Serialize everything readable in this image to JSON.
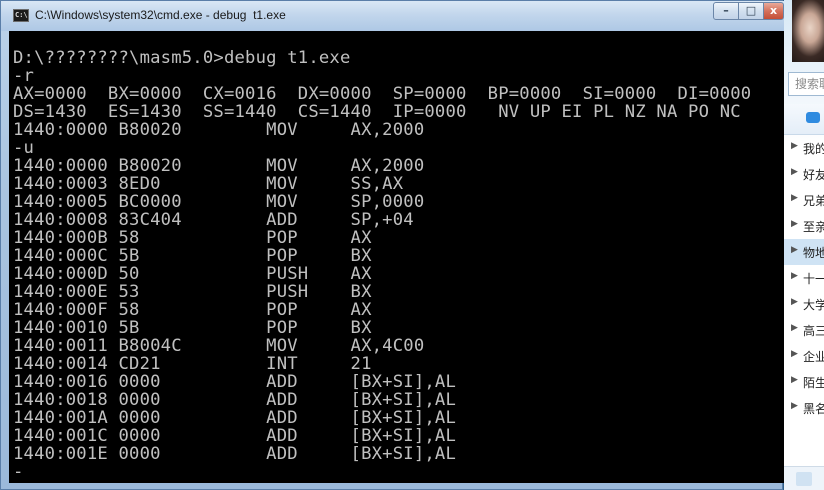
{
  "window": {
    "title": "C:\\Windows\\system32\\cmd.exe - debug  t1.exe",
    "icon_label": "C:\\",
    "controls": {
      "minimize": "–",
      "maximize": "□",
      "close": "x"
    }
  },
  "console": {
    "lines": [
      "D:\\????????\\masm5.0>debug t1.exe",
      "-r",
      "AX=0000  BX=0000  CX=0016  DX=0000  SP=0000  BP=0000  SI=0000  DI=0000",
      "DS=1430  ES=1430  SS=1440  CS=1440  IP=0000   NV UP EI PL NZ NA PO NC",
      "1440:0000 B80020        MOV     AX,2000",
      "-u",
      "1440:0000 B80020        MOV     AX,2000",
      "1440:0003 8ED0          MOV     SS,AX",
      "1440:0005 BC0000        MOV     SP,0000",
      "1440:0008 83C404        ADD     SP,+04",
      "1440:000B 58            POP     AX",
      "1440:000C 5B            POP     BX",
      "1440:000D 50            PUSH    AX",
      "1440:000E 53            PUSH    BX",
      "1440:000F 58            POP     AX",
      "1440:0010 5B            POP     BX",
      "1440:0011 B8004C        MOV     AX,4C00",
      "1440:0014 CD21          INT     21",
      "1440:0016 0000          ADD     [BX+SI],AL",
      "1440:0018 0000          ADD     [BX+SI],AL",
      "1440:001A 0000          ADD     [BX+SI],AL",
      "1440:001C 0000          ADD     [BX+SI],AL",
      "1440:001E 0000          ADD     [BX+SI],AL",
      "-"
    ],
    "colors": {
      "background": "#000000",
      "text": "#c0c0c0"
    }
  },
  "side_panel": {
    "search_placeholder": "搜索联",
    "groups": [
      {
        "label": "我的",
        "icon": "chevron-right-icon"
      },
      {
        "label": "好友",
        "icon": "chevron-right-icon"
      },
      {
        "label": "兄弟",
        "icon": "chevron-right-icon"
      },
      {
        "label": "至亲",
        "icon": "chevron-right-icon"
      },
      {
        "label": "物地",
        "icon": "chevron-right-icon"
      },
      {
        "label": "十一",
        "icon": "chevron-right-icon"
      },
      {
        "label": "大学",
        "icon": "chevron-right-icon"
      },
      {
        "label": "高三",
        "icon": "chevron-right-icon"
      },
      {
        "label": "企业",
        "icon": "chevron-right-icon"
      },
      {
        "label": "陌生",
        "icon": "chevron-right-icon"
      },
      {
        "label": "黑名",
        "icon": "chevron-right-icon"
      }
    ],
    "selected_group_index": 4
  }
}
